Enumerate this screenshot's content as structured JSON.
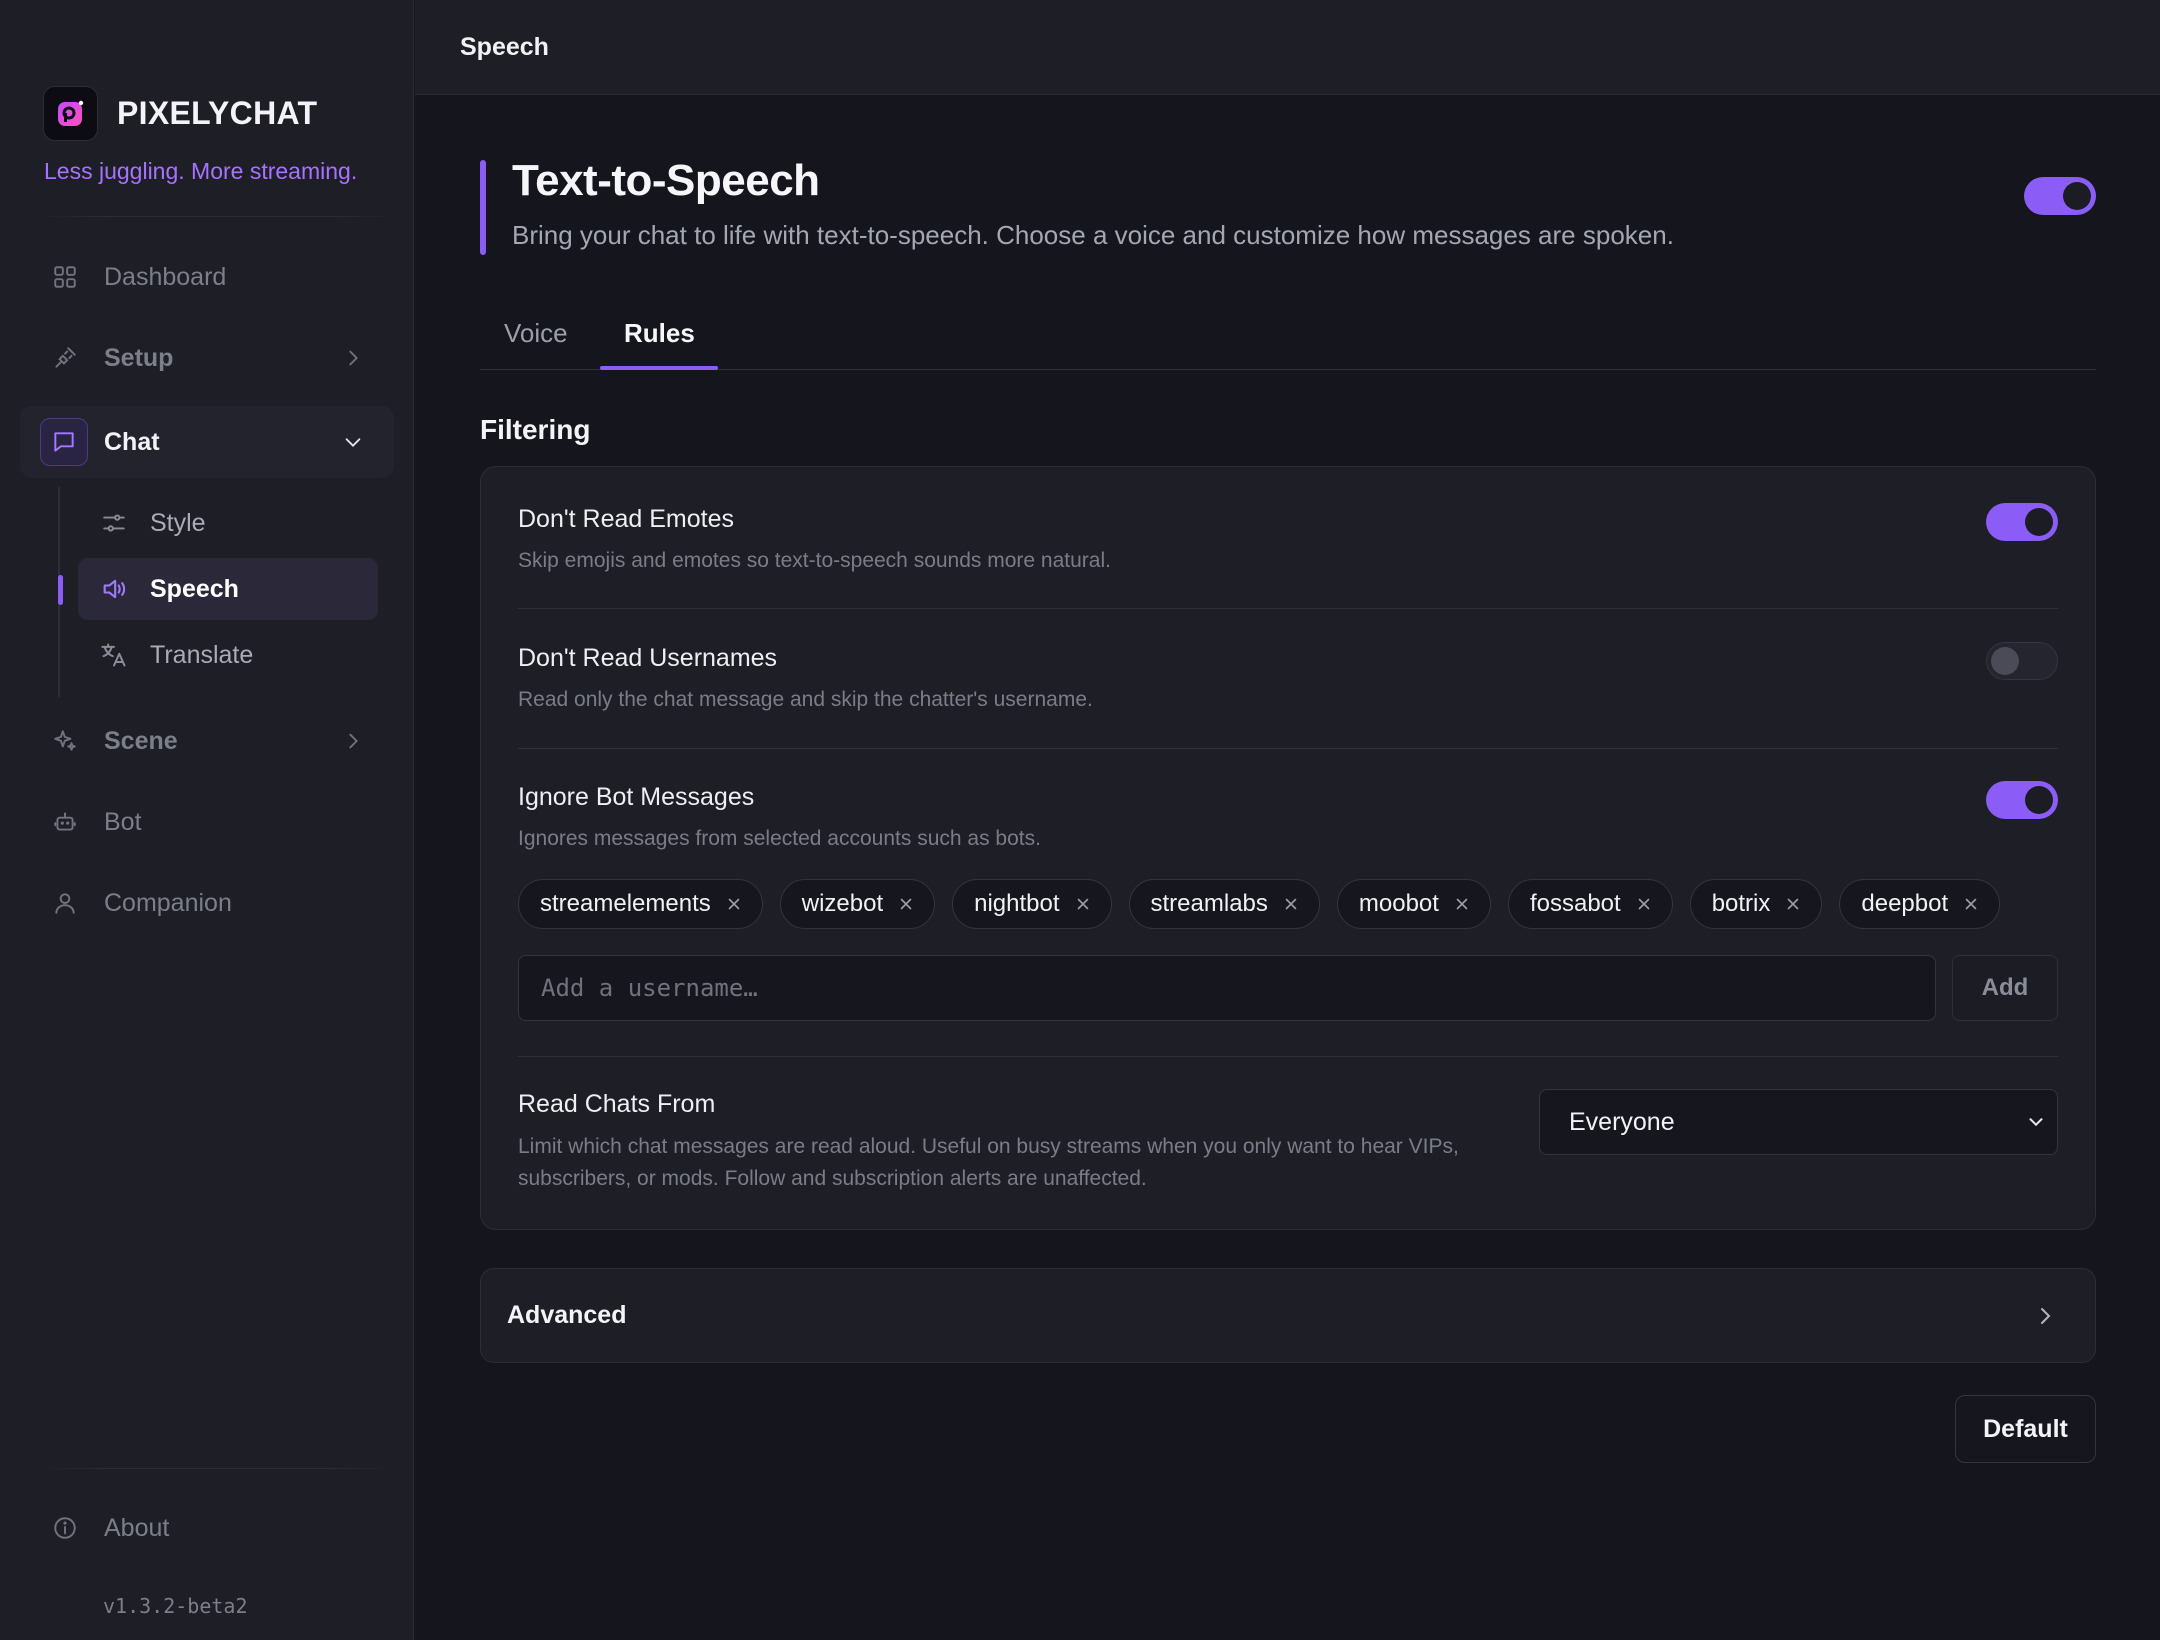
{
  "app": {
    "name": "PIXELYCHAT",
    "tagline": "Less juggling. More streaming.",
    "version": "v1.3.2-beta2",
    "accent_color": "#8b5cf6"
  },
  "topbar": {
    "title": "Speech"
  },
  "sidebar": {
    "items": [
      {
        "label": "Dashboard",
        "icon": "grid-icon"
      },
      {
        "label": "Setup",
        "icon": "plug-icon"
      },
      {
        "label": "Chat",
        "icon": "chat-bubble-icon",
        "expanded": true
      },
      {
        "label": "Scene",
        "icon": "sparkle-icon"
      },
      {
        "label": "Bot",
        "icon": "robot-icon"
      },
      {
        "label": "Companion",
        "icon": "user-icon"
      }
    ],
    "chat_sub_items": [
      {
        "label": "Style",
        "icon": "sliders-icon"
      },
      {
        "label": "Speech",
        "icon": "speaker-icon",
        "active": true
      },
      {
        "label": "Translate",
        "icon": "translate-icon"
      }
    ],
    "footer": {
      "about_label": "About",
      "icon": "info-icon"
    }
  },
  "header": {
    "title": "Text-to-Speech",
    "description": "Bring your chat to life with text-to-speech. Choose a voice and customize how messages are spoken.",
    "enabled": true
  },
  "tabs": [
    {
      "label": "Voice",
      "active": false
    },
    {
      "label": "Rules",
      "active": true
    }
  ],
  "filtering": {
    "section_title": "Filtering",
    "dont_read_emotes": {
      "title": "Don't Read Emotes",
      "description": "Skip emojis and emotes so text-to-speech sounds more natural.",
      "enabled": true
    },
    "dont_read_usernames": {
      "title": "Don't Read Usernames",
      "description": "Read only the chat message and skip the chatter's username.",
      "enabled": false
    },
    "ignore_bots": {
      "title": "Ignore Bot Messages",
      "description": "Ignores messages from selected accounts such as bots.",
      "enabled": true,
      "accounts": [
        "streamelements",
        "wizebot",
        "nightbot",
        "streamlabs",
        "moobot",
        "fossabot",
        "botrix",
        "deepbot"
      ],
      "input_placeholder": "Add a username…",
      "input_value": "",
      "add_label": "Add"
    },
    "read_chats_from": {
      "title": "Read Chats From",
      "description_line1": "Limit which chat messages are read aloud. Useful on busy streams when you only want to hear VIPs,",
      "description_line2": "subscribers, or mods. Follow and subscription alerts are unaffected.",
      "selected": "Everyone"
    }
  },
  "advanced": {
    "label": "Advanced"
  },
  "default_button": {
    "label": "Default"
  }
}
